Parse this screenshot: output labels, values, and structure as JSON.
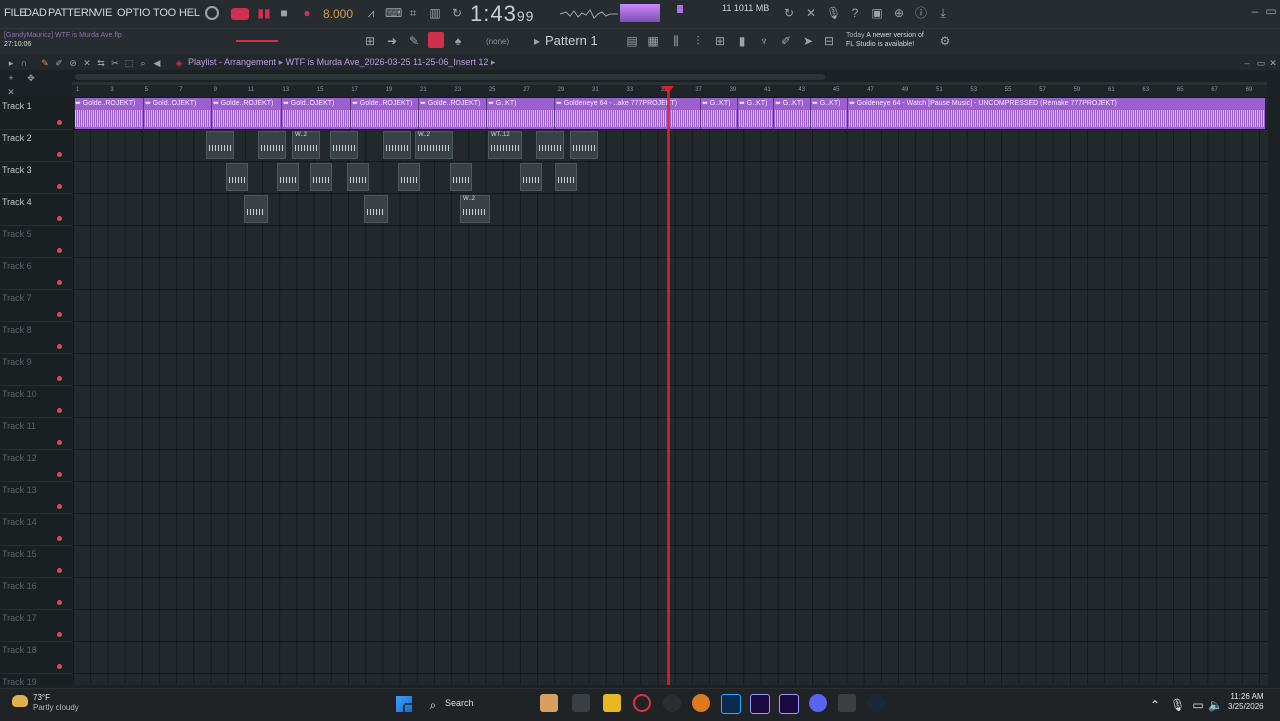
{
  "menu": [
    "FILE",
    "DAD",
    "PATTERN",
    "VIE",
    "OPTIO",
    "TOO",
    "HEL"
  ],
  "tempo": "8.000",
  "time": {
    "main": "1:43",
    "cs": "99"
  },
  "memory": "11  1011 MB",
  "file_hint": {
    "user": "[GandyMauricz] WTF is Murda Ave.flp",
    "time": "27:10:06"
  },
  "pattern": {
    "none": "(none)",
    "label": "Pattern 1"
  },
  "update": {
    "when": "Today",
    "text": "A newer version of",
    "text2": "FL Studio is available!"
  },
  "playlist": {
    "title": "Playlist - Arrangement",
    "project": "WTF is Murda Ave_2026-03-25 11-25-06_Insert 12"
  },
  "ruler_ticks": [
    "1",
    "3",
    "5",
    "7",
    "9",
    "11",
    "13",
    "15",
    "17",
    "19",
    "21",
    "23",
    "25",
    "27",
    "29",
    "31",
    "33",
    "35",
    "37",
    "39",
    "41",
    "43",
    "45",
    "47",
    "49",
    "51",
    "53",
    "55",
    "57",
    "59",
    "61",
    "63",
    "65",
    "67",
    "69"
  ],
  "tracks": [
    "Track 1",
    "Track 2",
    "Track 3",
    "Track 4",
    "Track 5",
    "Track 6",
    "Track 7",
    "Track 8",
    "Track 9",
    "Track 10",
    "Track 11",
    "Track 12",
    "Track 13",
    "Track 14",
    "Track 15",
    "Track 16",
    "Track 17",
    "Track 18",
    "Track 19"
  ],
  "clip_labels": [
    "⬌ Golde..ROJEKT)",
    "⬌ Gold..OJEKT)",
    "⬌ Golde..ROJEKT)",
    "⬌ Gold..OJEKT)",
    "⬌ Golde..ROJEKT)",
    "⬌ Golde..ROJEKT)",
    "⬌ G..KT)",
    "⬌ Goldeneye 64 - ..ake 777PROJEKT)",
    "⬌ G..KT)",
    "⬌ G..KT)",
    "⬌ G..KT)",
    "⬌ G..KT)",
    "⬌ Goldeneye 64 - Watch [Pause Music] - UNCOMPRESSED (Remake 777PROJEKT)"
  ],
  "mini_labels": [
    "W..2",
    "WT..12",
    "W..12",
    "W..2"
  ],
  "taskbar": {
    "temp": "73°F",
    "weather": "Partly cloudy",
    "search": "Search",
    "time": "11:26 AM",
    "date": "3/25/2026"
  },
  "colors": {
    "accent": "#9b5fd0",
    "playhead": "#e0202a",
    "record": "#d04a64"
  }
}
